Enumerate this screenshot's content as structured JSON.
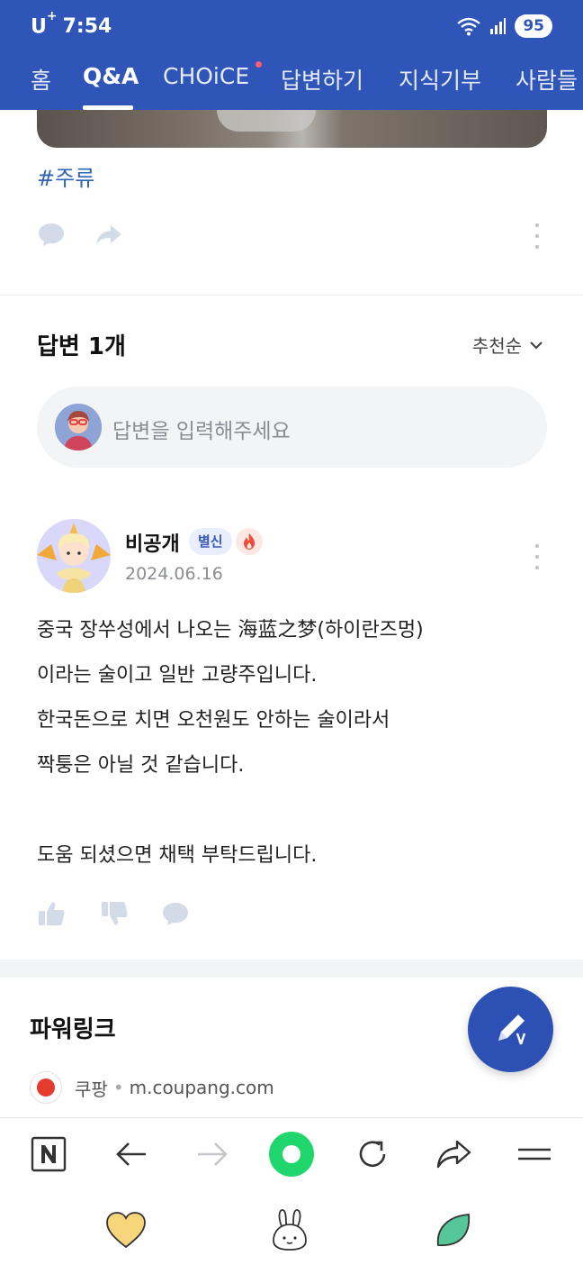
{
  "status_bar": {
    "carrier_prefix": "U",
    "carrier_sup": "+",
    "time": "7:54",
    "battery": "95"
  },
  "tabs": [
    {
      "label": "홈"
    },
    {
      "label": "Q&A",
      "active": true
    },
    {
      "label": "CHOiCE",
      "has_new_dot": true
    },
    {
      "label": "답변하기"
    },
    {
      "label": "지식기부"
    },
    {
      "label": "사람들"
    }
  ],
  "question": {
    "hashtag": "#주류"
  },
  "answers": {
    "title": "답변 1개",
    "sort_label": "추천순",
    "input_placeholder": "답변을 입력해주세요",
    "items": [
      {
        "author": "비공개",
        "rank_badge": "별신",
        "date": "2024.06.16",
        "body_lines": [
          "중국 장쑤성에서 나오는 海蓝之梦(하이란즈멍)",
          "이라는 술이고 일반 고량주입니다.",
          "한국돈으로 치면 오천원도 안하는 술이라서",
          "짝퉁은 아닐 것 같습니다.",
          "",
          "도움 되셨으면 채택 부탁드립니다."
        ]
      }
    ]
  },
  "power_link": {
    "title": "파워링크",
    "ad_name": "쿠팡",
    "ad_separator": "•",
    "ad_domain": "m.coupang.com"
  },
  "colors": {
    "header_bg": "#2f55b8",
    "accent_blue": "#2f64b3",
    "fab_bg": "#2d50b5",
    "green_button": "#1ed66b"
  },
  "icons": {
    "header": [
      "wifi-icon",
      "signal-icon",
      "battery-icon"
    ],
    "question_actions": [
      "comment-icon",
      "share-icon",
      "more-icon"
    ],
    "answer_actions": [
      "thumbs-up-icon",
      "thumbs-down-icon",
      "comment-icon"
    ],
    "bottom_bar": [
      "naver-home-icon",
      "back-arrow-icon",
      "forward-arrow-icon",
      "green-dot-button-icon",
      "refresh-icon",
      "share-icon",
      "menu-icon"
    ],
    "shortcuts": [
      "heart-icon",
      "rabbit-icon",
      "leaf-icon"
    ],
    "fab": "write-answer-icon"
  }
}
